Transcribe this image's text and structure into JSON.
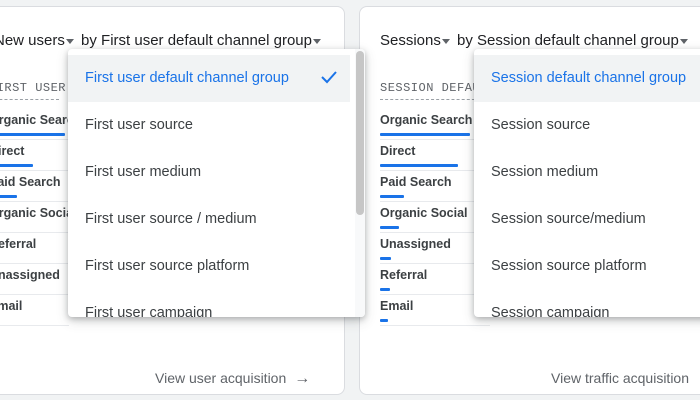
{
  "left_card": {
    "title_prefix": "New users",
    "title_mid": "by First user default channel group",
    "column_header": "FIRST USER DEFAULT CHANNEL GROUP",
    "rows": [
      {
        "label": "Organic Search",
        "share": 0.95
      },
      {
        "label": "Direct",
        "share": 0.55
      },
      {
        "label": "Paid Search",
        "share": 0.35
      },
      {
        "label": "Organic Social",
        "share": 0.1
      },
      {
        "label": "Referral",
        "share": 0.05
      },
      {
        "label": "Unassigned",
        "share": 0.04
      },
      {
        "label": "Email",
        "share": 0.03
      }
    ],
    "view_link": "View user acquisition",
    "menu": {
      "items": [
        "First user default channel group",
        "First user source",
        "First user medium",
        "First user source / medium",
        "First user source platform",
        "First user campaign"
      ],
      "selected_index": 0
    }
  },
  "right_card": {
    "title_prefix": "Sessions",
    "title_mid": "by Session default channel group",
    "column_header": "SESSION DEFAULT CHANNEL GROUP",
    "rows": [
      {
        "label": "Organic Search",
        "share": 0.95
      },
      {
        "label": "Direct",
        "share": 0.82
      },
      {
        "label": "Paid Search",
        "share": 0.25
      },
      {
        "label": "Organic Social",
        "share": 0.2
      },
      {
        "label": "Unassigned",
        "share": 0.12
      },
      {
        "label": "Referral",
        "share": 0.1
      },
      {
        "label": "Email",
        "share": 0.08
      }
    ],
    "view_link": "View traffic acquisition",
    "menu": {
      "items": [
        "Session default channel group",
        "Session source",
        "Session medium",
        "Session source/medium",
        "Session source platform",
        "Session campaign"
      ],
      "selected_index": 0
    }
  },
  "colors": {
    "accent": "#1a73e8",
    "text": "#202124",
    "muted": "#5f6368",
    "card_bg": "#ffffff",
    "page_bg": "#f1f3f4"
  }
}
